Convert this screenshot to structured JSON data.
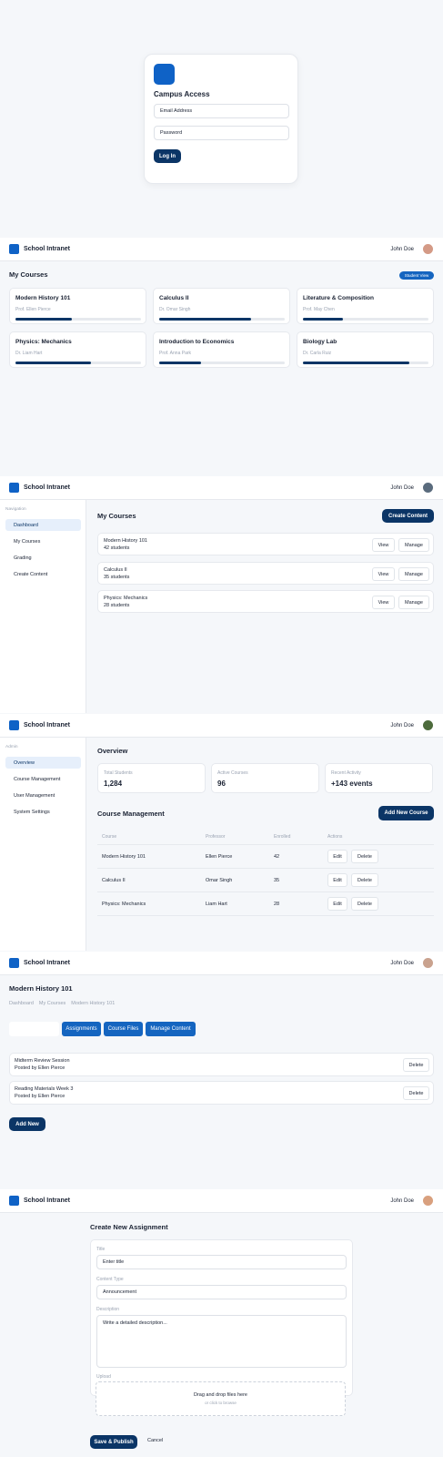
{
  "login": {
    "title": "Campus Access",
    "email_placeholder": "Email Address",
    "password_placeholder": "Password",
    "login_label": "Log In"
  },
  "header": {
    "brand": "School Intranet",
    "user": "John Doe"
  },
  "student_view": {
    "title": "My Courses",
    "badge": "Student View",
    "courses": [
      {
        "name": "Modern History 101",
        "prof": "Prof. Ellen Pierce",
        "progress": 0.45
      },
      {
        "name": "Calculus II",
        "prof": "Dr. Omar Singh",
        "progress": 0.73
      },
      {
        "name": "Literature & Composition",
        "prof": "Prof. May Chen",
        "progress": 0.32
      },
      {
        "name": "Physics: Mechanics",
        "prof": "Dr. Liam Hart",
        "progress": 0.6
      },
      {
        "name": "Introduction to Economics",
        "prof": "Prof. Anna Park",
        "progress": 0.33
      },
      {
        "name": "Biology Lab",
        "prof": "Dr. Carla Ruiz",
        "progress": 0.85
      }
    ]
  },
  "teacher_view": {
    "nav_heading": "Navigation",
    "nav": [
      "Dashboard",
      "My Courses",
      "Grading",
      "Create Content"
    ],
    "title": "My Courses",
    "create_label": "Create Content",
    "view_label": "View",
    "manage_label": "Manage",
    "courses": [
      {
        "name": "Modern History 101",
        "students": "42 students"
      },
      {
        "name": "Calculus II",
        "students": "35 students"
      },
      {
        "name": "Physics: Mechanics",
        "students": "28 students"
      }
    ]
  },
  "admin_view": {
    "nav_heading": "Admin",
    "nav": [
      "Overview",
      "Course Management",
      "User Management",
      "System Settings"
    ],
    "overview_title": "Overview",
    "stats": [
      {
        "label": "Total Students",
        "value": "1,284"
      },
      {
        "label": "Active Courses",
        "value": "96"
      },
      {
        "label": "Recent Activity",
        "value": "+143 events"
      }
    ],
    "management_title": "Course Management",
    "add_label": "Add New Course",
    "columns": [
      "Course",
      "Professor",
      "Enrolled",
      "Actions"
    ],
    "edit_label": "Edit",
    "delete_label": "Delete",
    "rows": [
      {
        "course": "Modern History 101",
        "professor": "Ellen Pierce",
        "enrolled": "42"
      },
      {
        "course": "Calculus II",
        "professor": "Omar Singh",
        "enrolled": "35"
      },
      {
        "course": "Physics: Mechanics",
        "professor": "Liam Hart",
        "enrolled": "28"
      }
    ]
  },
  "course_view": {
    "title": "Modern History 101",
    "breadcrumb": [
      "Dashboard",
      "My Courses",
      "Modern History 101"
    ],
    "tabs": [
      "Assignments",
      "Course Files",
      "Manage Content"
    ],
    "delete_label": "Delete",
    "items": [
      {
        "title": "Midterm Review Session",
        "by": "Posted by Ellen Pierce"
      },
      {
        "title": "Reading Materials Week 3",
        "by": "Posted by Ellen Pierce"
      }
    ],
    "add_label": "Add New"
  },
  "create_view": {
    "title": "Create New Assignment",
    "title_label": "Title",
    "title_placeholder": "Enter title",
    "type_label": "Content Type",
    "type_value": "Announcement",
    "desc_label": "Description",
    "desc_placeholder": "Write a detailed description...",
    "upload_label": "Upload",
    "upload_text": "Drag and drop files here",
    "upload_sub": "or click to browse",
    "save_label": "Save & Publish",
    "cancel_label": "Cancel"
  }
}
